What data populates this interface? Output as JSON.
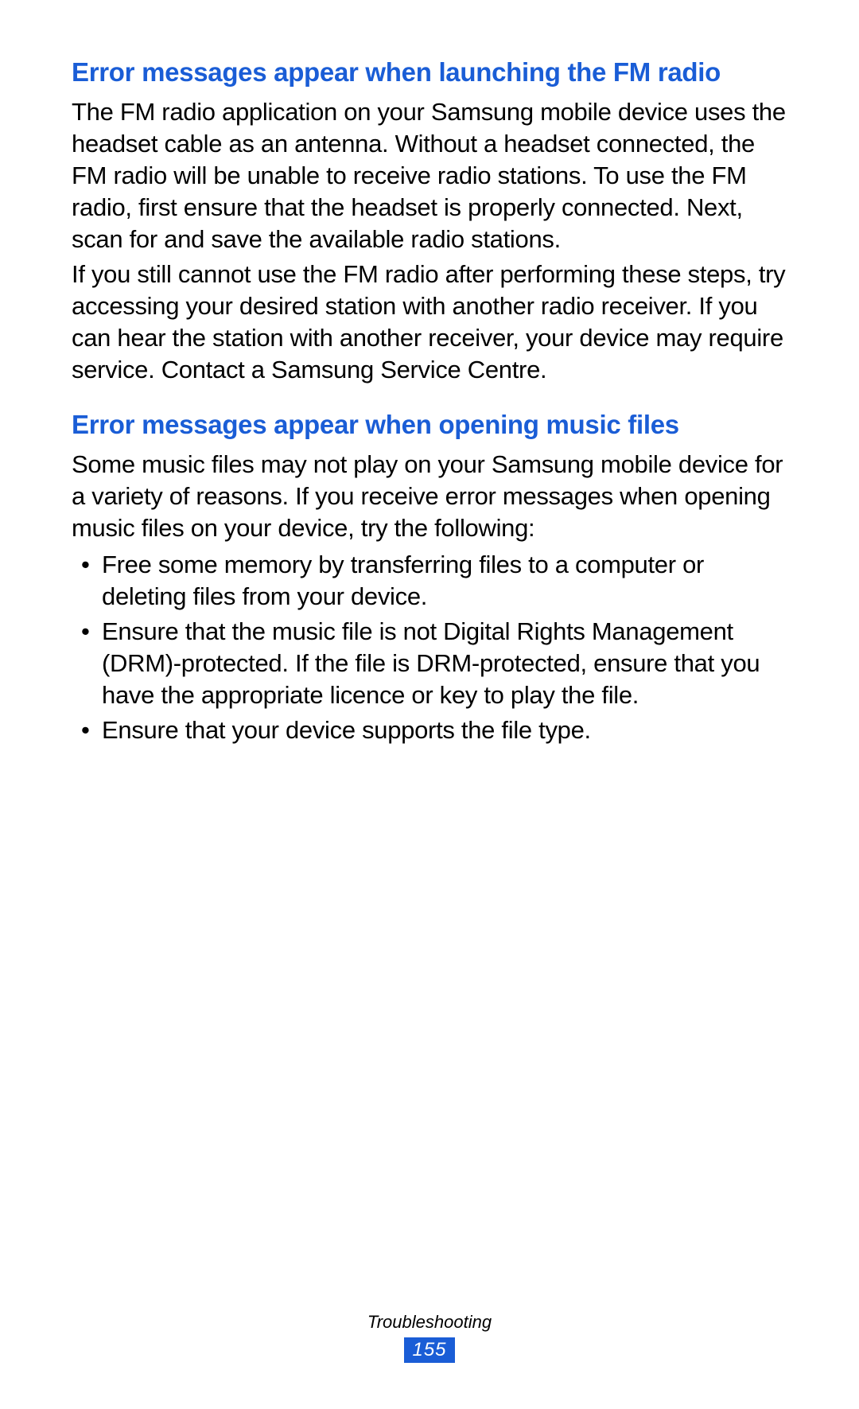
{
  "section1": {
    "heading": "Error messages appear when launching the FM radio",
    "para1": "The FM radio application on your Samsung mobile device uses the headset cable as an antenna. Without a headset connected, the FM radio will be unable to receive radio stations. To use the FM radio, first ensure that the headset is properly connected. Next, scan for and save the available radio stations.",
    "para2": "If you still cannot use the FM radio after performing these steps, try accessing your desired station with another radio receiver. If you can hear the station with another receiver, your device may require service. Contact a Samsung Service Centre."
  },
  "section2": {
    "heading": "Error messages appear when opening music files",
    "para1": "Some music files may not play on your Samsung mobile device for a variety of reasons. If you receive error messages when opening music files on your device, try the following:",
    "bullets": [
      "Free some memory by transferring files to a computer or deleting files from your device.",
      "Ensure that the music file is not Digital Rights Management (DRM)-protected. If the file is DRM-protected, ensure that you have the appropriate licence or key to play the file.",
      "Ensure that your device supports the file type."
    ]
  },
  "footer": {
    "label": "Troubleshooting",
    "page": "155"
  }
}
